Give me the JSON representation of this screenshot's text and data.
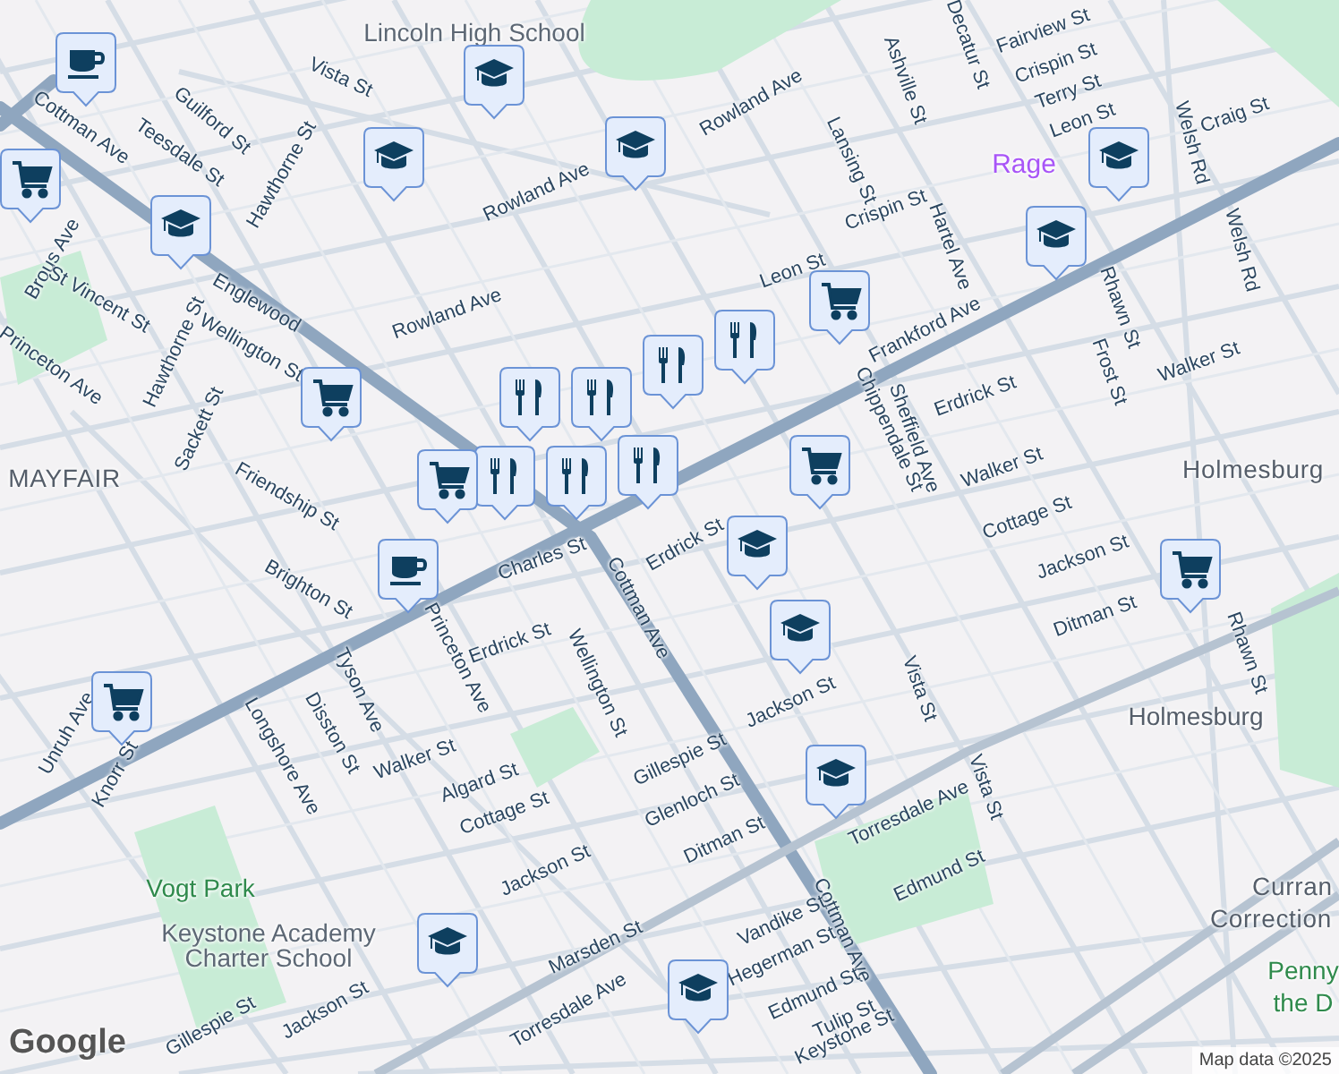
{
  "map": {
    "labels": [
      {
        "text": "Lincoln High School",
        "kind": "poi"
      },
      {
        "text": "Vista St",
        "kind": "street"
      },
      {
        "text": "Guilford St",
        "kind": "street"
      },
      {
        "text": "Teesdale St",
        "kind": "street"
      },
      {
        "text": "Hawthorne St",
        "kind": "street"
      },
      {
        "text": "Cottman Ave",
        "kind": "street"
      },
      {
        "text": "Brous Ave",
        "kind": "street"
      },
      {
        "text": "St Vincent St",
        "kind": "street"
      },
      {
        "text": "Hawthorne St",
        "kind": "street"
      },
      {
        "text": "Englewood",
        "kind": "street"
      },
      {
        "text": "Wellington St",
        "kind": "street"
      },
      {
        "text": "Princeton Ave",
        "kind": "street"
      },
      {
        "text": "Sackett St",
        "kind": "street"
      },
      {
        "text": "MAYFAIR",
        "kind": "area"
      },
      {
        "text": "Friendship St",
        "kind": "street"
      },
      {
        "text": "Rowland Ave",
        "kind": "street"
      },
      {
        "text": "Rowland Ave",
        "kind": "street"
      },
      {
        "text": "Rowland Ave",
        "kind": "street"
      },
      {
        "text": "Crispin St",
        "kind": "street"
      },
      {
        "text": "Lansing St",
        "kind": "street"
      },
      {
        "text": "Ashville St",
        "kind": "street"
      },
      {
        "text": "Decatur St",
        "kind": "street"
      },
      {
        "text": "Fairview St",
        "kind": "street"
      },
      {
        "text": "Crispin St",
        "kind": "street"
      },
      {
        "text": "Terry St",
        "kind": "street"
      },
      {
        "text": "Leon St",
        "kind": "street"
      },
      {
        "text": "Craig St",
        "kind": "street"
      },
      {
        "text": "Welsh Rd",
        "kind": "street"
      },
      {
        "text": "Welsh Rd",
        "kind": "street"
      },
      {
        "text": "Rage",
        "kind": "place"
      },
      {
        "text": "Hartel Ave",
        "kind": "street"
      },
      {
        "text": "Leon St",
        "kind": "street"
      },
      {
        "text": "Frankford Ave",
        "kind": "street"
      },
      {
        "text": "Rhawn St",
        "kind": "street"
      },
      {
        "text": "Frost St",
        "kind": "street"
      },
      {
        "text": "Walker St",
        "kind": "street"
      },
      {
        "text": "Erdrick St",
        "kind": "street"
      },
      {
        "text": "Sheffield Ave",
        "kind": "street"
      },
      {
        "text": "Chippendale St",
        "kind": "street"
      },
      {
        "text": "Walker St",
        "kind": "street"
      },
      {
        "text": "Cottage St",
        "kind": "street"
      },
      {
        "text": "Jackson St",
        "kind": "street"
      },
      {
        "text": "Ditman St",
        "kind": "street"
      },
      {
        "text": "Holmesburg",
        "kind": "area"
      },
      {
        "text": "Rhawn St",
        "kind": "street"
      },
      {
        "text": "Holmesburg",
        "kind": "station"
      },
      {
        "text": "Vista St",
        "kind": "street"
      },
      {
        "text": "Vista St",
        "kind": "street"
      },
      {
        "text": "Torresdale Ave",
        "kind": "street"
      },
      {
        "text": "Jackson St",
        "kind": "street"
      },
      {
        "text": "Erdrick St",
        "kind": "street"
      },
      {
        "text": "Charles St",
        "kind": "street"
      },
      {
        "text": "Erdrick St",
        "kind": "street"
      },
      {
        "text": "Wellington St",
        "kind": "street"
      },
      {
        "text": "Cottman Ave",
        "kind": "street"
      },
      {
        "text": "Princeton Ave",
        "kind": "street"
      },
      {
        "text": "Brighton St",
        "kind": "street"
      },
      {
        "text": "Tyson Ave",
        "kind": "street"
      },
      {
        "text": "Disston St",
        "kind": "street"
      },
      {
        "text": "Longshore Ave",
        "kind": "street"
      },
      {
        "text": "Walker St",
        "kind": "street"
      },
      {
        "text": "Algard St",
        "kind": "street"
      },
      {
        "text": "Cottage St",
        "kind": "street"
      },
      {
        "text": "Gillespie St",
        "kind": "street"
      },
      {
        "text": "Glenloch St",
        "kind": "street"
      },
      {
        "text": "Ditman St",
        "kind": "street"
      },
      {
        "text": "Jackson St",
        "kind": "street"
      },
      {
        "text": "Cottman Ave",
        "kind": "street"
      },
      {
        "text": "Edmund St",
        "kind": "street"
      },
      {
        "text": "Vogt Park",
        "kind": "park"
      },
      {
        "text": "Keystone Academy Charter School",
        "kind": "poi"
      },
      {
        "text": "Marsden St",
        "kind": "street"
      },
      {
        "text": "Torresdale Ave",
        "kind": "street"
      },
      {
        "text": "Vandike St",
        "kind": "street"
      },
      {
        "text": "Hegerman St",
        "kind": "street"
      },
      {
        "text": "Edmund St",
        "kind": "street"
      },
      {
        "text": "Tulip St",
        "kind": "street"
      },
      {
        "text": "Keystone St",
        "kind": "street"
      },
      {
        "text": "Jackson St",
        "kind": "street"
      },
      {
        "text": "Gillespie St",
        "kind": "street"
      },
      {
        "text": "Unruh Ave",
        "kind": "street"
      },
      {
        "text": "Knorr St",
        "kind": "street"
      },
      {
        "text": "Curran",
        "kind": "area"
      },
      {
        "text": "Correction",
        "kind": "area"
      },
      {
        "text": "Penny",
        "kind": "park"
      },
      {
        "text": "the D",
        "kind": "park"
      }
    ],
    "markers": [
      {
        "kind": "cafe"
      },
      {
        "kind": "school"
      },
      {
        "kind": "school"
      },
      {
        "kind": "school"
      },
      {
        "kind": "shop"
      },
      {
        "kind": "school"
      },
      {
        "kind": "school"
      },
      {
        "kind": "school"
      },
      {
        "kind": "shop"
      },
      {
        "kind": "shop"
      },
      {
        "kind": "food"
      },
      {
        "kind": "food"
      },
      {
        "kind": "food"
      },
      {
        "kind": "food"
      },
      {
        "kind": "food"
      },
      {
        "kind": "food"
      },
      {
        "kind": "food"
      },
      {
        "kind": "shop"
      },
      {
        "kind": "cafe"
      },
      {
        "kind": "shop"
      },
      {
        "kind": "school"
      },
      {
        "kind": "school"
      },
      {
        "kind": "shop"
      },
      {
        "kind": "shop"
      },
      {
        "kind": "school"
      },
      {
        "kind": "school"
      },
      {
        "kind": "school"
      }
    ],
    "attribution": "Map data ©2025",
    "logo": "Google"
  }
}
